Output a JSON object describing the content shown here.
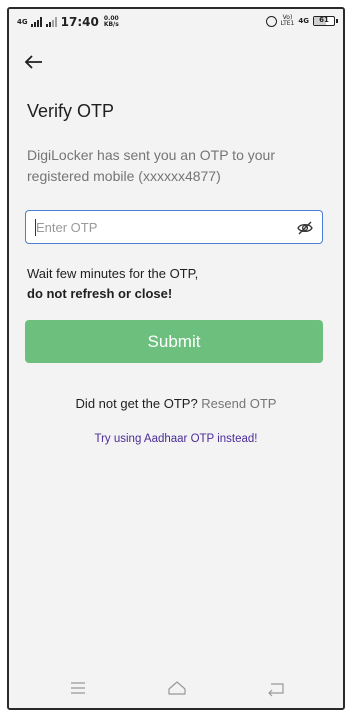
{
  "status_bar": {
    "network_type": "4G",
    "time": "17:40",
    "speed_value": "0.00",
    "speed_unit": "KB/s",
    "volte_top": "Vo)",
    "volte_bottom": "LTE1",
    "signal2_type": "4G",
    "battery_level": "61"
  },
  "header": {
    "back_icon": "arrow-left-icon"
  },
  "main": {
    "title": "Verify OTP",
    "description": "DigiLocker has sent you an OTP to your registered mobile (xxxxxx4877)",
    "otp_input": {
      "placeholder": "Enter OTP",
      "value": "",
      "toggle_icon": "eye-off-icon"
    },
    "wait_line1": "Wait few minutes for the OTP,",
    "wait_line2": "do not refresh or close!",
    "submit_label": "Submit",
    "resend_prompt": "Did not get the OTP?",
    "resend_link": "Resend OTP",
    "aadhaar_link": "Try using Aadhaar OTP instead!"
  },
  "navigation_bar": {
    "items": [
      "menu-icon",
      "home-icon",
      "back-icon"
    ]
  },
  "colors": {
    "submit_background": "#6dbf7e",
    "input_border": "#4a7fd6",
    "aadhaar_link": "#4b2c9a",
    "muted_text": "#757575"
  }
}
